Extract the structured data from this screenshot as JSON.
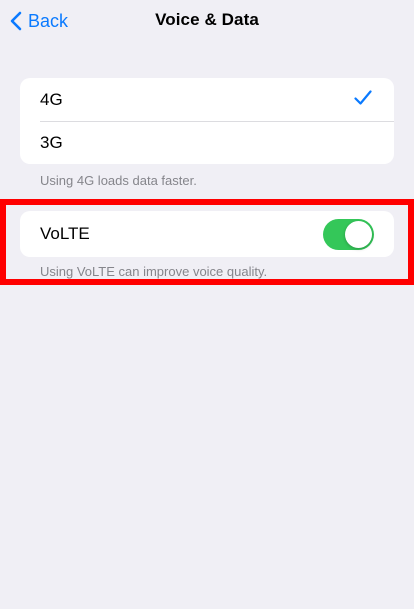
{
  "nav": {
    "back_label": "Back",
    "title": "Voice & Data",
    "accent_color": "#0a7aff"
  },
  "speed_section": {
    "options": [
      {
        "label": "4G",
        "selected": true
      },
      {
        "label": "3G",
        "selected": false
      }
    ],
    "footer": "Using 4G loads data faster."
  },
  "volte_section": {
    "label": "VoLTE",
    "enabled": true,
    "toggle_color": "#34c759",
    "footer": "Using VoLTE can improve voice quality."
  },
  "highlight": {
    "color": "#ff0000"
  }
}
